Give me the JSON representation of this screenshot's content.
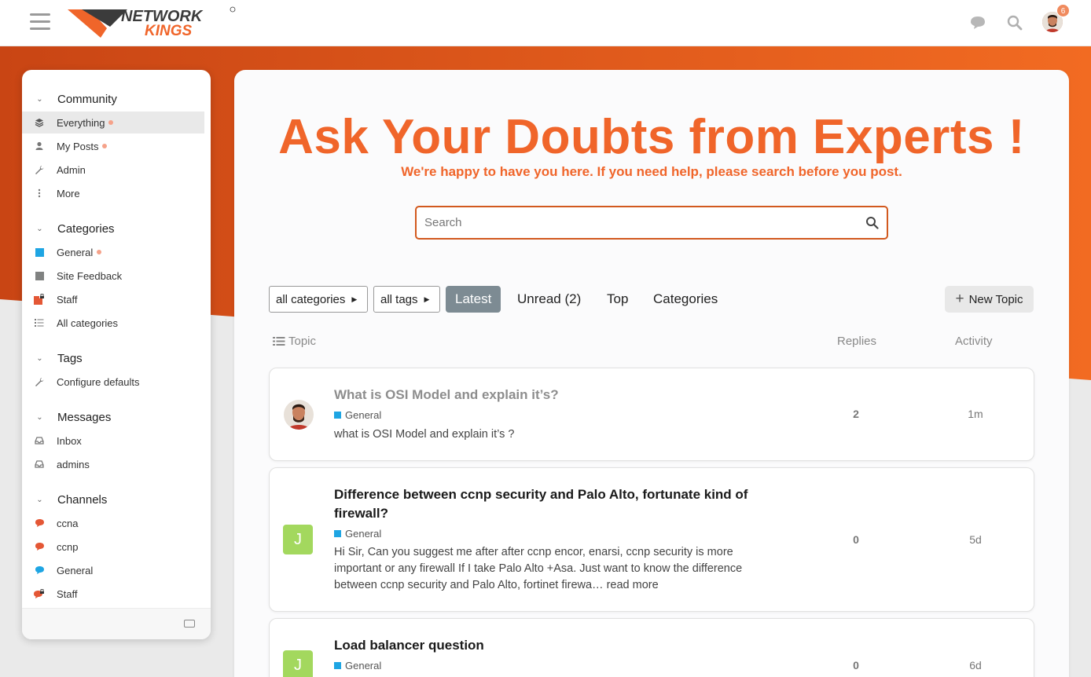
{
  "header": {
    "logo_text_top": "NETWORK",
    "logo_text_bottom": "KINGS",
    "notifications_count": "6"
  },
  "sidebar": {
    "sections": [
      {
        "title": "Community",
        "items": [
          "Everything",
          "My Posts",
          "Admin",
          "More"
        ]
      },
      {
        "title": "Categories",
        "items": [
          "General",
          "Site Feedback",
          "Staff",
          "All categories"
        ]
      },
      {
        "title": "Tags",
        "items": [
          "Configure defaults"
        ]
      },
      {
        "title": "Messages",
        "items": [
          "Inbox",
          "admins"
        ]
      },
      {
        "title": "Channels",
        "items": [
          "ccna",
          "ccnp",
          "General",
          "Staff"
        ]
      }
    ]
  },
  "hero": {
    "title": "Ask Your Doubts from Experts !",
    "subtitle": "We're happy to have you here. If you need help, please search before you post.",
    "search_placeholder": "Search"
  },
  "nav": {
    "categories_dropdown": "all categories",
    "tags_dropdown": "all tags",
    "latest": "Latest",
    "unread": "Unread (2)",
    "top": "Top",
    "categories": "Categories",
    "new_topic": "New Topic"
  },
  "columns": {
    "topic": "Topic",
    "replies": "Replies",
    "activity": "Activity"
  },
  "topics": [
    {
      "title": "What is OSI Model and explain it’s?",
      "category": "General",
      "excerpt": "what is OSI Model and explain it’s ?",
      "replies": "2",
      "activity": "1m"
    },
    {
      "title": "Difference between ccnp security and Palo Alto, fortunate kind of firewall?",
      "category": "General",
      "excerpt": "Hi Sir, Can you suggest me after after ccnp encor, enarsi, ccnp security is more important or any firewall If I take Palo Alto +Asa. Just want to know the difference between ccnp security and Palo Alto, fortinet firewa… read more",
      "avatar_letter": "J",
      "replies": "0",
      "activity": "5d"
    },
    {
      "title": "Load balancer question",
      "category": "General",
      "avatar_letter": "J",
      "replies": "0",
      "activity": "6d"
    }
  ],
  "colors": {
    "accent": "#f0652a",
    "orange_dark": "#d2501a",
    "latest_pill": "#7d8b93",
    "category_general": "#1ea5e3",
    "category_feedback": "#808281",
    "category_staff": "#e45735",
    "avatar_j": "#a3d85e"
  }
}
